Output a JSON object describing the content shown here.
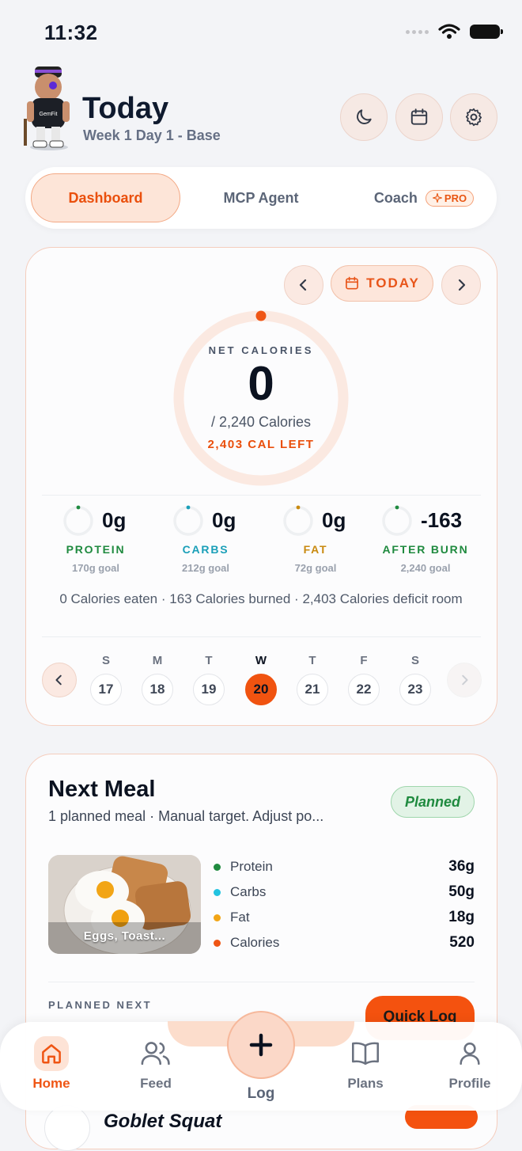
{
  "status": {
    "time": "11:32"
  },
  "header": {
    "title": "Today",
    "subtitle": "Week 1 Day 1 - Base",
    "avatar_name": "mascot-avatar",
    "actions": [
      "moon-icon",
      "calendar-icon",
      "gear-icon"
    ]
  },
  "tabs": [
    {
      "label": "Dashboard",
      "active": true
    },
    {
      "label": "MCP Agent"
    },
    {
      "label": "Coach",
      "badge": "PRO"
    }
  ],
  "calories": {
    "date_label": "TODAY",
    "net_label": "NET CALORIES",
    "net_value": "0",
    "target": "/ 2,240 Calories",
    "left": "2,403 CAL LEFT"
  },
  "macros": [
    {
      "value": "0g",
      "name": "PROTEIN",
      "goal": "170g goal",
      "color": "#1f8a3f"
    },
    {
      "value": "0g",
      "name": "CARBS",
      "goal": "212g goal",
      "color": "#1a9fb8"
    },
    {
      "value": "0g",
      "name": "FAT",
      "goal": "72g goal",
      "color": "#c98a10"
    },
    {
      "value": "-163",
      "name": "AFTER BURN",
      "goal": "2,240 goal",
      "color": "#1f8a3f"
    }
  ],
  "summary": "0 Calories eaten · 163 Calories burned · 2,403 Calories deficit room",
  "week": [
    {
      "letter": "S",
      "num": "17"
    },
    {
      "letter": "M",
      "num": "18"
    },
    {
      "letter": "T",
      "num": "19"
    },
    {
      "letter": "W",
      "num": "20",
      "selected": true
    },
    {
      "letter": "T",
      "num": "21"
    },
    {
      "letter": "F",
      "num": "22"
    },
    {
      "letter": "S",
      "num": "23"
    }
  ],
  "next_meal": {
    "title": "Next Meal",
    "subtitle": "1 planned meal · Manual target. Adjust po...",
    "status": "Planned",
    "image_label": "Eggs, Toast...",
    "nutrients": [
      {
        "label": "Protein",
        "value": "36g",
        "color": "#1f8a3f"
      },
      {
        "label": "Carbs",
        "value": "50g",
        "color": "#22c3e0"
      },
      {
        "label": "Fat",
        "value": "18g",
        "color": "#f2a516"
      },
      {
        "label": "Calories",
        "value": "520",
        "color": "#ef5514"
      }
    ],
    "planned_next_label": "PLANNED NEXT",
    "quick_log": "Quick Log"
  },
  "peek": {
    "title": "Goblet Squat"
  },
  "nav": [
    {
      "label": "Home",
      "active": true
    },
    {
      "label": "Feed"
    },
    {
      "label": "Log"
    },
    {
      "label": "Plans"
    },
    {
      "label": "Profile"
    }
  ],
  "colors": {
    "accent": "#ef5514",
    "background": "#f3f4f7"
  }
}
